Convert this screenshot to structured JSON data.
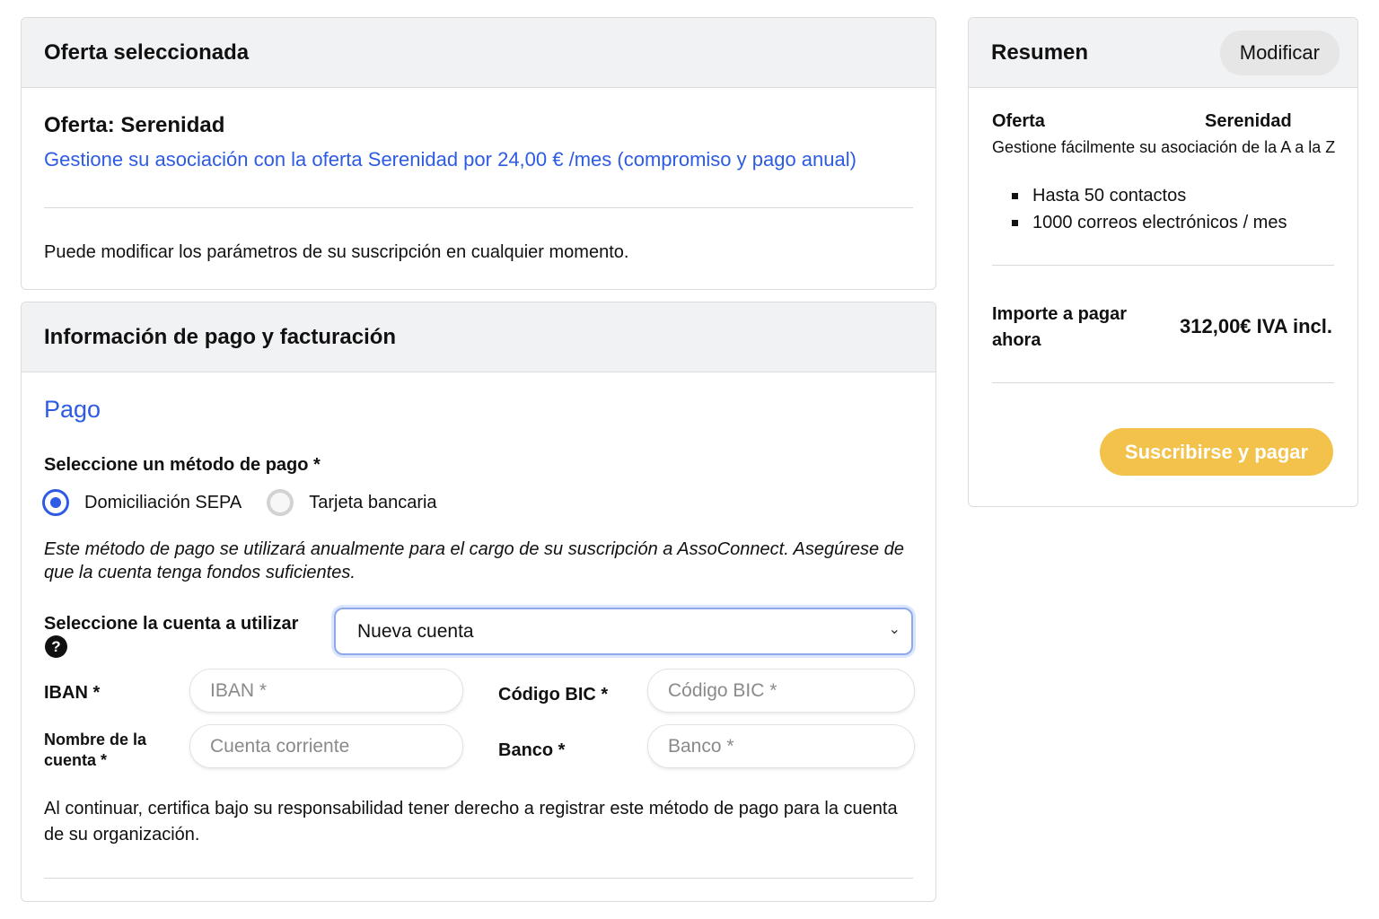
{
  "offer_card": {
    "header": "Oferta seleccionada",
    "title": "Oferta: Serenidad",
    "description": "Gestione su asociación con la oferta Serenidad por 24,00 € /mes (compromiso y pago anual)",
    "note": "Puede modificar los parámetros de su suscripción en cualquier momento."
  },
  "payment_card": {
    "header": "Información de pago y facturación",
    "section_title": "Pago",
    "method_label": "Seleccione un método de pago *",
    "methods": [
      {
        "label": "Domiciliación SEPA",
        "selected": true
      },
      {
        "label": "Tarjeta bancaria",
        "selected": false
      }
    ],
    "method_note": "Este método de pago se utilizará anualmente para el cargo de su suscripción a AssoConnect. Asegúrese de que la cuenta tenga fondos suficientes.",
    "account_label": "Seleccione la cuenta a utilizar",
    "help_icon": "question-circle-icon",
    "account_select_value": "Nueva cuenta",
    "fields": {
      "iban_label": "IBAN *",
      "iban_placeholder": "IBAN *",
      "bic_label": "Código BIC *",
      "bic_placeholder": "Código BIC *",
      "account_name_label": "Nombre de la cuenta *",
      "account_name_placeholder": "Cuenta corriente",
      "bank_label": "Banco *",
      "bank_placeholder": "Banco *"
    },
    "certification": "Al continuar, certifica bajo su responsabilidad tener derecho a registrar este método de pago para la cuenta de su organización."
  },
  "summary_card": {
    "header": "Resumen",
    "modify_label": "Modificar",
    "offer_label": "Oferta",
    "offer_value": "Serenidad",
    "offer_desc": "Gestione fácilmente su asociación de la A a la Z",
    "features": [
      "Hasta 50 contactos",
      "1000 correos electrónicos / mes"
    ],
    "amount_label": "Importe a pagar ahora",
    "amount_value": "312,00€ IVA incl.",
    "pay_button": "Suscribirse y pagar"
  },
  "colors": {
    "accent_blue": "#2d5be3",
    "pay_button": "#f2c24b",
    "header_bg": "#f1f2f4"
  }
}
